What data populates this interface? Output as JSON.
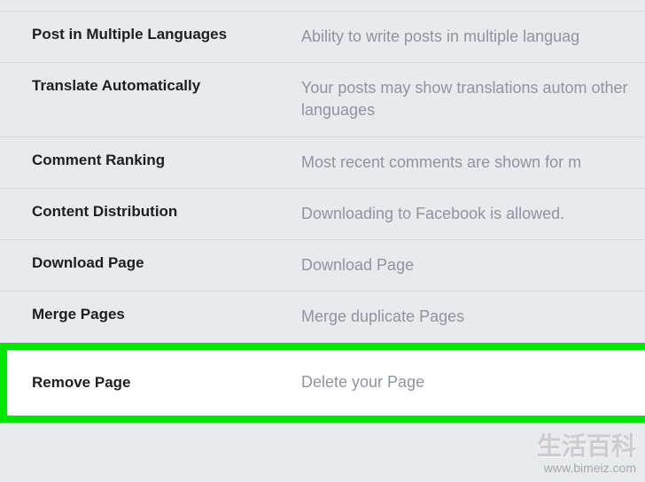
{
  "settings": [
    {
      "label": "",
      "value": ""
    },
    {
      "label": "Post in Multiple Languages",
      "value": "Ability to write posts in multiple languag"
    },
    {
      "label": "Translate Automatically",
      "value": "Your posts may show translations autom other languages"
    },
    {
      "label": "Comment Ranking",
      "value": "Most recent comments are shown for m"
    },
    {
      "label": "Content Distribution",
      "value": "Downloading to Facebook is allowed."
    },
    {
      "label": "Download Page",
      "value": "Download Page"
    },
    {
      "label": "Merge Pages",
      "value": "Merge duplicate Pages"
    }
  ],
  "highlighted": {
    "label": "Remove Page",
    "value": "Delete your Page"
  },
  "watermark": {
    "main": "生活百科",
    "sub": "www.bimeiz.com"
  }
}
